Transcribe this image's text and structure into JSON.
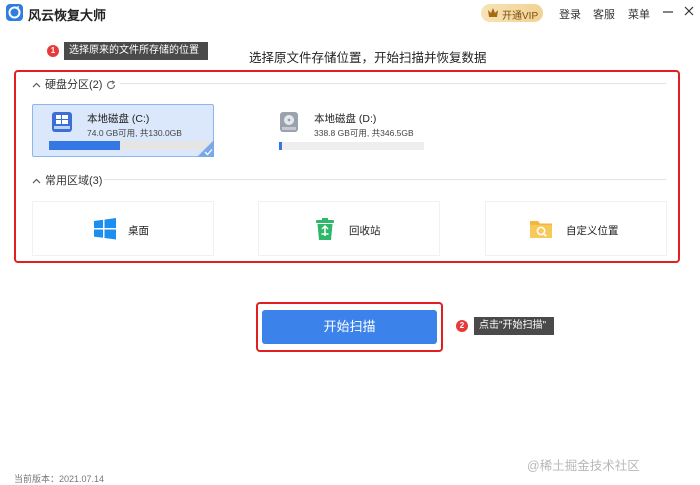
{
  "app": {
    "title": "风云恢复大师",
    "logo_icon": "app-logo-icon"
  },
  "header": {
    "vip_label": "开通VIP",
    "login_label": "登录",
    "service_label": "客服",
    "menu_label": "菜单",
    "minimize_icon": "minimize-icon",
    "close_icon": "close-icon"
  },
  "step1": {
    "number": "1",
    "tip": "选择原来的文件所存储的位置"
  },
  "instruction": "选择原文件存储位置，开始扫描并恢复数据",
  "disk_section": {
    "title": "硬盘分区(2)",
    "drives": [
      {
        "name": "本地磁盘 (C:)",
        "space": "74.0 GB可用, 共130.0GB",
        "used_fraction": 0.43,
        "selected": true,
        "icon": "windows-drive-icon"
      },
      {
        "name": "本地磁盘 (D:)",
        "space": "338.8 GB可用, 共346.5GB",
        "used_fraction": 0.022,
        "selected": false,
        "icon": "hard-drive-icon"
      }
    ]
  },
  "common_section": {
    "title": "常用区域(3)",
    "locations": [
      {
        "label": "桌面",
        "icon": "windows-desktop-icon"
      },
      {
        "label": "回收站",
        "icon": "recycle-bin-icon"
      },
      {
        "label": "自定义位置",
        "icon": "folder-search-icon"
      }
    ]
  },
  "scan_button": "开始扫描",
  "step2": {
    "number": "2",
    "tip": "点击\"开始扫描\""
  },
  "version": "当前版本：2021.07.14",
  "watermark": "@稀土掘金技术社区",
  "colors": {
    "accent": "#3b82ea",
    "highlight_red": "#e02020",
    "tip_bg": "#4a4a4a",
    "vip_gold": "#f2d294"
  }
}
